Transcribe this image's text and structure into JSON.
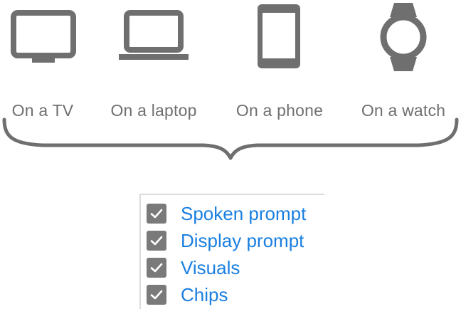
{
  "devices": [
    {
      "label": "On a TV",
      "icon": "tv-icon"
    },
    {
      "label": "On a laptop",
      "icon": "laptop-icon"
    },
    {
      "label": "On a phone",
      "icon": "phone-icon"
    },
    {
      "label": "On a watch",
      "icon": "watch-icon"
    }
  ],
  "checklist": {
    "items": [
      {
        "label": "Spoken prompt",
        "checked": true
      },
      {
        "label": "Display prompt",
        "checked": true
      },
      {
        "label": "Visuals",
        "checked": true
      },
      {
        "label": "Chips",
        "checked": true
      }
    ]
  },
  "colors": {
    "icon": "#6f6f6f",
    "label": "#6f6f6f",
    "brace": "#6f6f6f",
    "checkbox": "#7a7a7a",
    "checklist_text": "#1a7fe0",
    "checklist_border": "#dcdcdc"
  }
}
